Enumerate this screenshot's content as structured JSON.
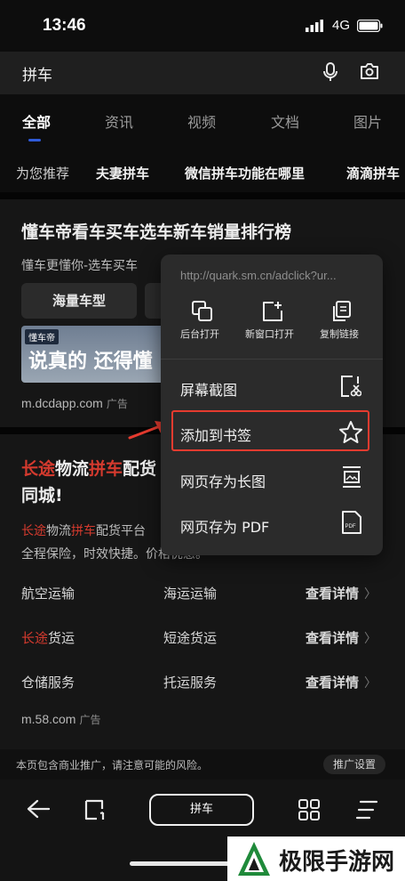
{
  "status": {
    "time": "13:46",
    "network": "4G"
  },
  "search": {
    "query": "拼车"
  },
  "tabs": [
    "全部",
    "资讯",
    "视频",
    "文档",
    "图片"
  ],
  "chips": [
    "为您推荐",
    "夫妻拼车",
    "微信拼车功能在哪里",
    "滴滴拼车"
  ],
  "card1": {
    "title": "懂车帝看车买车选车新车销量排行榜",
    "subtitle": "懂车更懂你-选车买车",
    "button": "海量车型",
    "banner_logo": "懂车帝",
    "banner_slogan": "说真的 还得懂",
    "source": "m.dcdapp.com",
    "ad": "广告"
  },
  "card2": {
    "title_line1": [
      "长途",
      "物流",
      "拼车",
      "配货"
    ],
    "title_line2": "同城!",
    "desc_line1": [
      "长途",
      "物流",
      "拼车",
      "配货平台"
    ],
    "desc_line2": "全程保险，时效快捷。价格优惠。",
    "rows": [
      {
        "left": "航空运输",
        "left_red": "",
        "mid": "海运运输",
        "detail": "查看详情"
      },
      {
        "left": "货运",
        "left_red": "长途",
        "mid": "短途货运",
        "detail": "查看详情"
      },
      {
        "left": "仓储服务",
        "left_red": "",
        "mid": "托运服务",
        "detail": "查看详情"
      }
    ],
    "source": "m.58.com",
    "ad": "广告"
  },
  "disclaimer": "本页包含商业推广，请注意可能的风险。",
  "promo_settings": "推广设置",
  "address_pill": "拼车",
  "menu": {
    "url": "http://quark.sm.cn/adclick?ur...",
    "quick": [
      {
        "label": "后台打开",
        "icon": "background-open-icon"
      },
      {
        "label": "新窗口打开",
        "icon": "new-window-icon"
      },
      {
        "label": "复制链接",
        "icon": "copy-link-icon"
      }
    ],
    "items": [
      {
        "label": "屏幕截图",
        "icon": "screenshot-icon"
      },
      {
        "label": "添加到书签",
        "icon": "star-icon"
      },
      {
        "label": "网页存为长图",
        "icon": "long-image-icon"
      },
      {
        "label": "网页存为 PDF",
        "icon": "pdf-icon"
      }
    ]
  },
  "colors": {
    "highlight": "#e63b2f",
    "accent_red": "#d43a2e",
    "tab_underline": "#2f5bd8"
  },
  "watermark": "极限手游网"
}
